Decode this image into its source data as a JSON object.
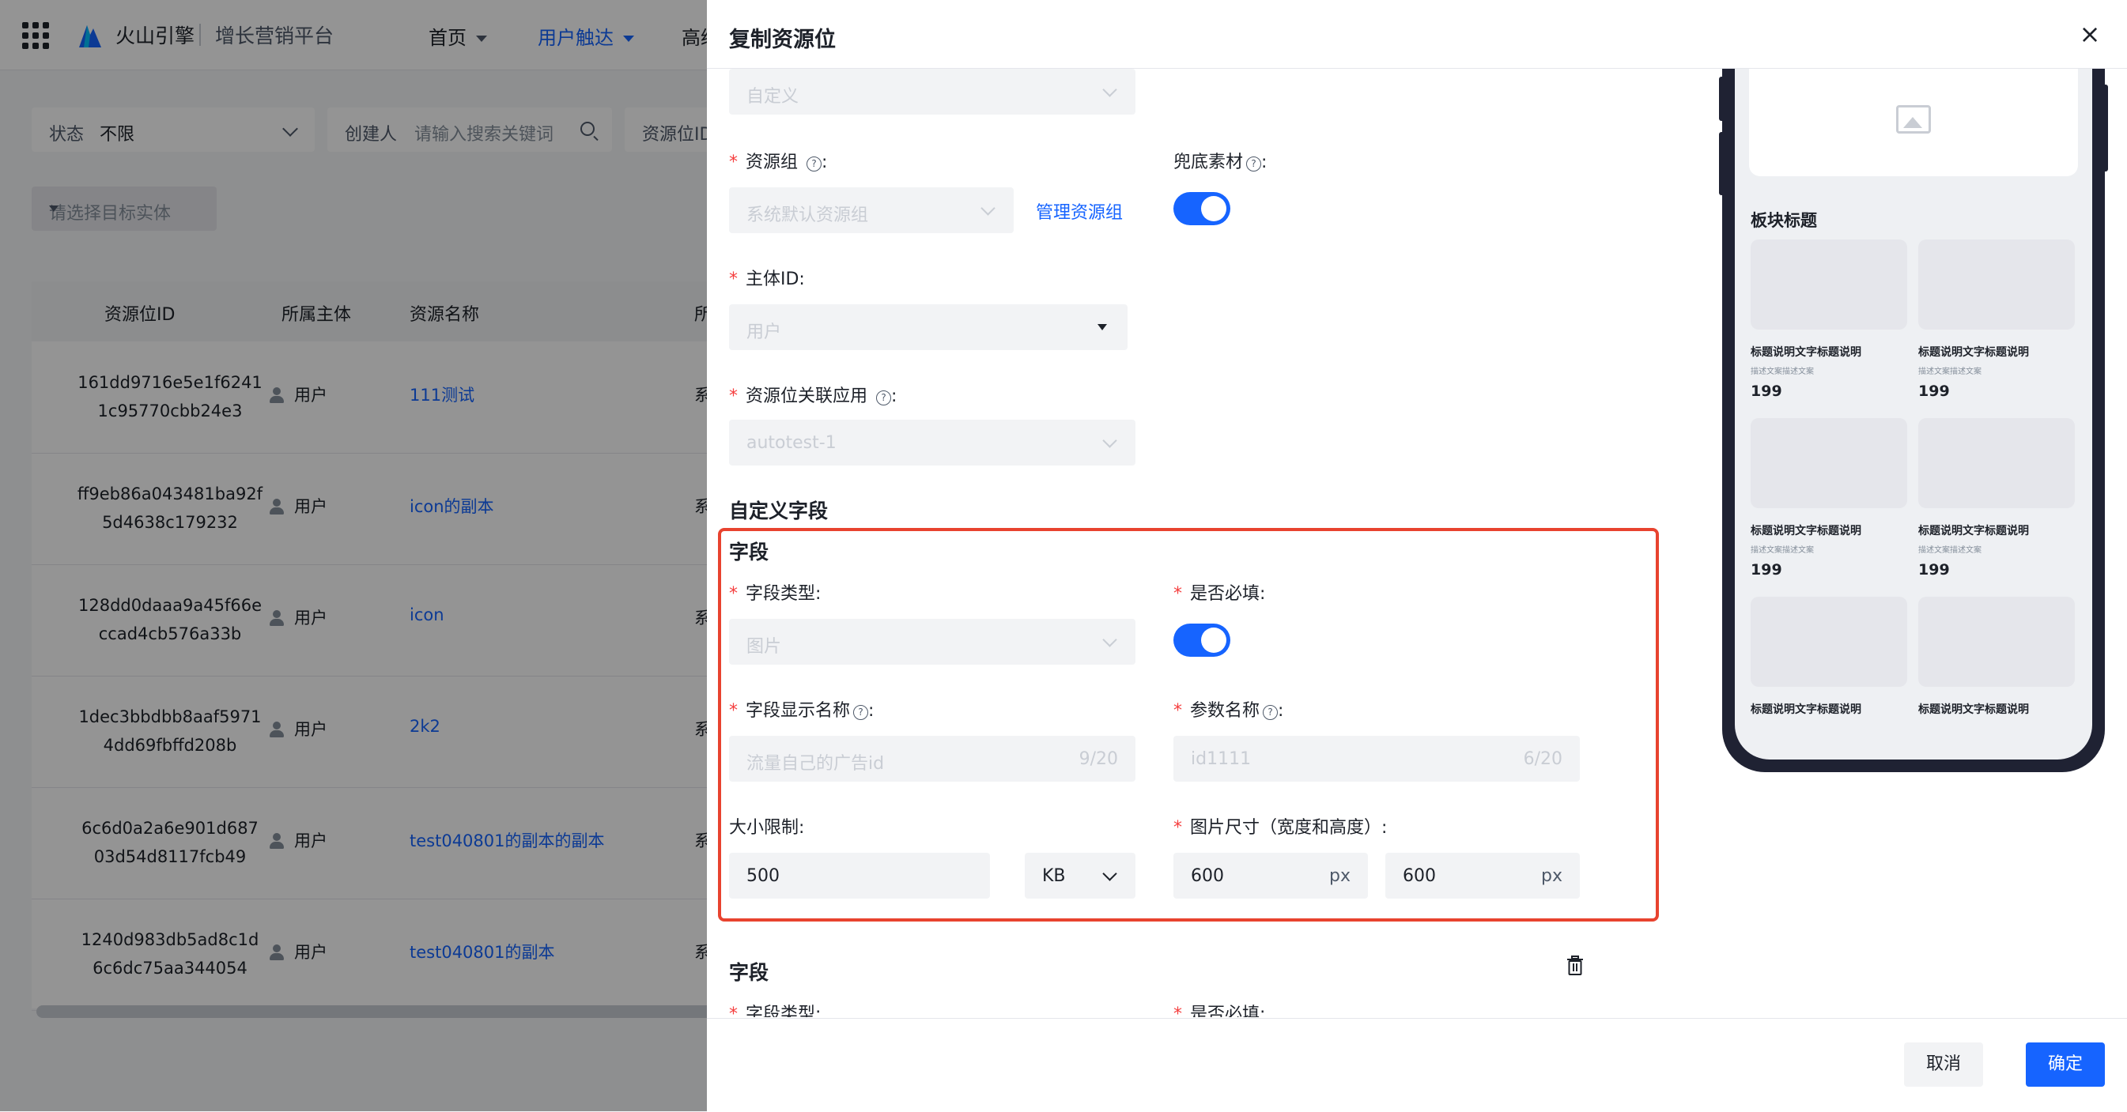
{
  "topbar": {
    "brand": "火山引擎",
    "platform": "增长营销平台",
    "nav": [
      {
        "label": "首页"
      },
      {
        "label": "用户触达"
      },
      {
        "label": "高级"
      }
    ]
  },
  "filters": {
    "status_label": "状态",
    "status_value": "不限",
    "creator_label": "创建人",
    "creator_placeholder": "请输入搜索关键词",
    "resource_label": "资源位ID",
    "entity_placeholder": "请选择目标实体"
  },
  "table": {
    "headers": [
      "资源位ID",
      "所属主体",
      "资源名称",
      "所"
    ],
    "rows": [
      {
        "id1": "161dd9716e5e1f6241",
        "id2": "1c95770cbb24e3",
        "owner": "用户",
        "name": "111测试",
        "type": "系"
      },
      {
        "id1": "ff9eb86a043481ba92f",
        "id2": "5d4638c179232",
        "owner": "用户",
        "name": "icon的副本",
        "type": "系"
      },
      {
        "id1": "128dd0daaa9a45f66e",
        "id2": "ccad4cb576a33b",
        "owner": "用户",
        "name": "icon",
        "type": "系"
      },
      {
        "id1": "1dec3bbdbb8aaf5971",
        "id2": "4dd69fbffd208b",
        "owner": "用户",
        "name": "2k2",
        "type": "系"
      },
      {
        "id1": "6c6d0a2a6e901d687",
        "id2": "03d54d8117fcb49",
        "owner": "用户",
        "name": "test040801的副本的副本",
        "type": "系"
      },
      {
        "id1": "1240d983db5ad8c1d",
        "id2": "6c6dc75aa344054",
        "owner": "用户",
        "name": "test040801的副本",
        "type": "系"
      }
    ]
  },
  "drawer": {
    "title": "复制资源位",
    "close": "×",
    "top_select": "自定义",
    "resource_group_label": "资源组",
    "resource_group_value": "系统默认资源组",
    "manage_group_link": "管理资源组",
    "fallback_label": "兜底素材",
    "subject_id_label": "主体ID:",
    "subject_id_value": "用户",
    "app_label": "资源位关联应用",
    "app_value": "autotest-1",
    "custom_fields_title": "自定义字段",
    "field1": {
      "title": "字段",
      "type_label": "字段类型:",
      "type_value": "图片",
      "required_label": "是否必填:",
      "display_name_label": "字段显示名称",
      "display_name_value": "流量自己的广告id",
      "display_name_count": "9/20",
      "param_name_label": "参数名称",
      "param_name_value": "id1111",
      "param_name_count": "6/20",
      "size_limit_label": "大小限制:",
      "size_limit_value": "500",
      "size_unit": "KB",
      "img_size_label": "图片尺寸（宽度和高度）:",
      "img_width": "600",
      "img_height": "600",
      "px_unit": "px"
    },
    "field2": {
      "title": "字段",
      "type_label": "字段类型:",
      "required_label": "是否必填:"
    },
    "cancel": "取消",
    "confirm": "确定"
  },
  "preview": {
    "block_title": "板块标题",
    "cards": [
      {
        "title": "标题说明文字标题说明",
        "desc": "描述文案描述文案",
        "price": "199"
      },
      {
        "title": "标题说明文字标题说明",
        "desc": "描述文案描述文案",
        "price": "199"
      },
      {
        "title": "标题说明文字标题说明",
        "desc": "描述文案描述文案",
        "price": "199"
      },
      {
        "title": "标题说明文字标题说明",
        "desc": "描述文案描述文案",
        "price": "199"
      },
      {
        "title": "标题说明文字标题说明",
        "desc": "",
        "price": ""
      },
      {
        "title": "标题说明文字标题说明",
        "desc": "",
        "price": ""
      }
    ]
  },
  "colors": {
    "primary": "#1664ff",
    "required": "#f53f3f",
    "highlight": "#e8432f"
  }
}
